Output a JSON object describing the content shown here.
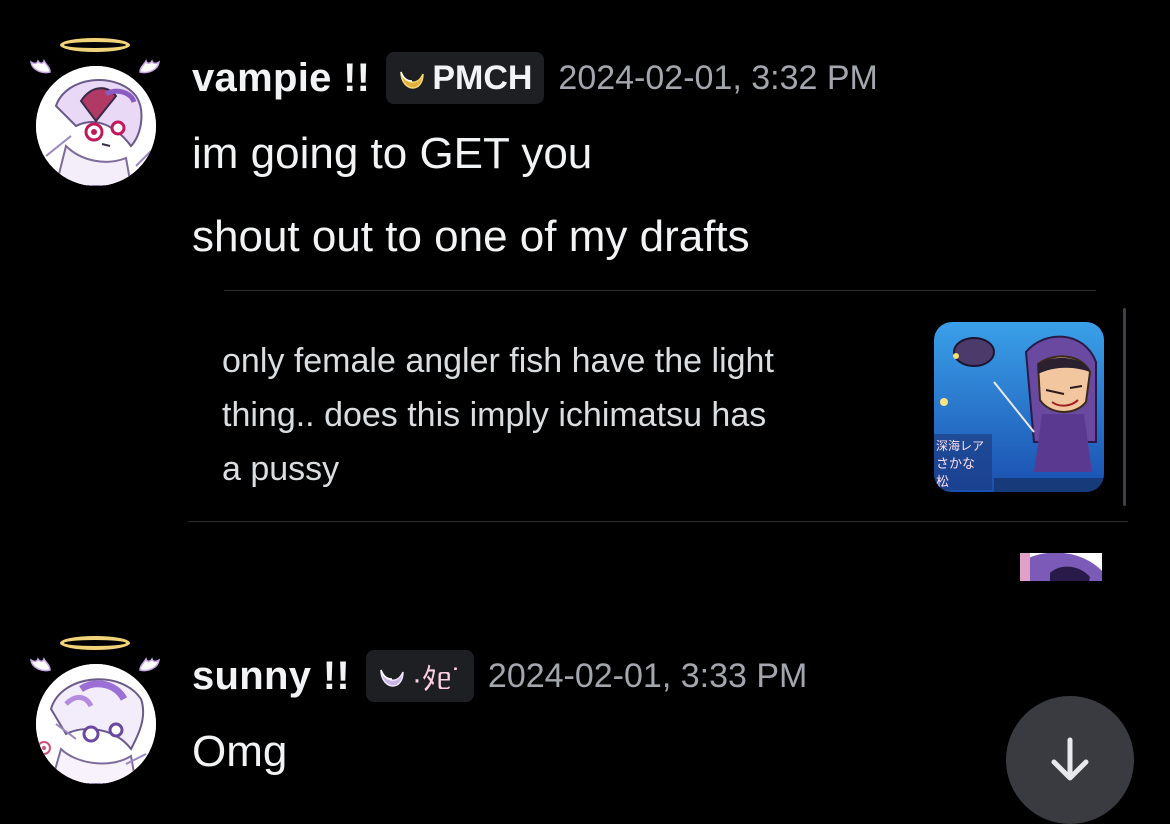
{
  "messages": [
    {
      "username": "vampie !!",
      "tag_text": "PMCH",
      "timestamp": "2024-02-01, 3:32 PM",
      "lines": [
        "im going to GET you",
        "shout out to one of my drafts"
      ],
      "embed": {
        "lines": [
          "only female angler fish have the light",
          "thing.. does this imply ichimatsu has",
          "a pussy"
        ],
        "thumb_text": [
          "深海レア",
          "さかな",
          "松"
        ]
      }
    },
    {
      "username": "sunny !!",
      "tag_text": "·ﾀᥱ˙",
      "timestamp": "2024-02-01, 3:33 PM",
      "lines": [
        "Omg"
      ]
    }
  ],
  "colors": {
    "background": "#000000",
    "tag_bg": "#1e1f22",
    "timestamp": "#a3a6ad",
    "halo": "#f2d37a",
    "tag_icon_gold": "#e0b13a",
    "tag_icon_lilac": "#c9b6e4",
    "scroll_button": "#3a3b40"
  },
  "icons": {
    "scroll": "arrow-down-icon",
    "tag_1": "moon-icon",
    "tag_2": "moon-icon"
  }
}
